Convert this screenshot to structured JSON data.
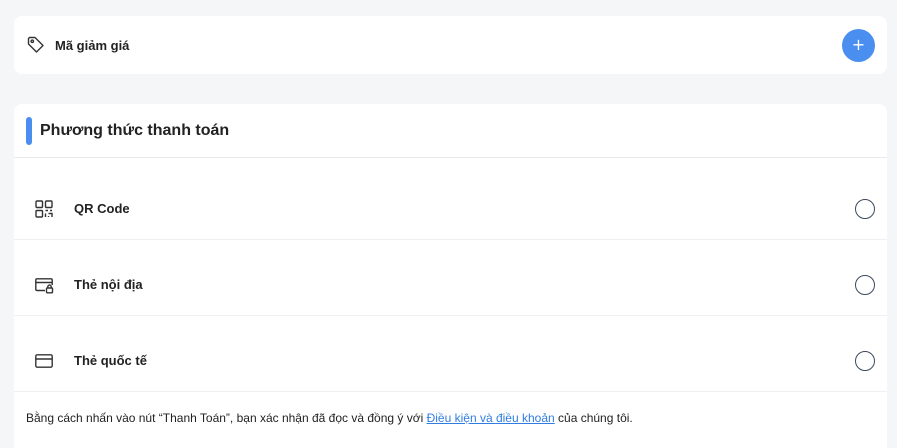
{
  "coupon": {
    "label": "Mã giảm giá",
    "add_symbol": "+"
  },
  "payment": {
    "title": "Phương thức thanh toán",
    "methods": [
      {
        "label": "QR Code",
        "icon": "qr-code-icon",
        "selected": false
      },
      {
        "label": "Thẻ nội địa",
        "icon": "domestic-card-icon",
        "selected": false
      },
      {
        "label": "Thẻ quốc tế",
        "icon": "credit-card-icon",
        "selected": false
      }
    ],
    "terms": {
      "prefix": "Bằng cách nhấn vào nút “Thanh Toán”, bạn xác nhận đã đọc và đồng ý với ",
      "link": "Điều kiện và điều khoản",
      "suffix": " của chúng tôi."
    }
  },
  "colors": {
    "accent": "#4a8ff0",
    "link": "#2f7de1",
    "background": "#f5f6f8"
  }
}
